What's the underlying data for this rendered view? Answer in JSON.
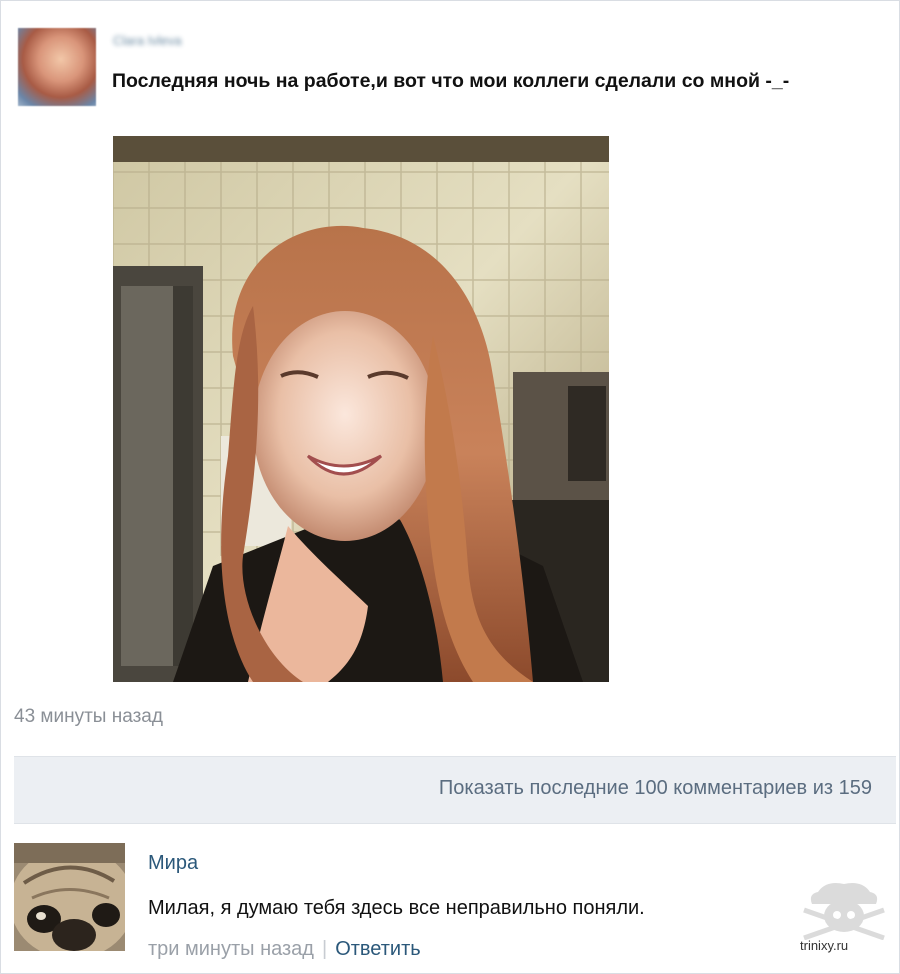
{
  "post": {
    "author": "Clara Ivleva",
    "text": "Последняя ночь на работе,и вот что мои коллеги сделали со мной -_-",
    "time": "43 минуты назад"
  },
  "comments_bar": {
    "label": "Показать последние 100 комментариев из 159"
  },
  "comment": {
    "author": "Мира",
    "text": "Милая, я думаю тебя здесь все неправильно поняли.",
    "time": "три минуты назад",
    "separator": "|",
    "reply_label": "Ответить"
  },
  "watermark": {
    "text": "trinixy.ru",
    "icon": "chef-skull-icon"
  },
  "colors": {
    "link": "#2b587a",
    "meta": "#8a8f96",
    "bar_bg": "#eceff3"
  }
}
